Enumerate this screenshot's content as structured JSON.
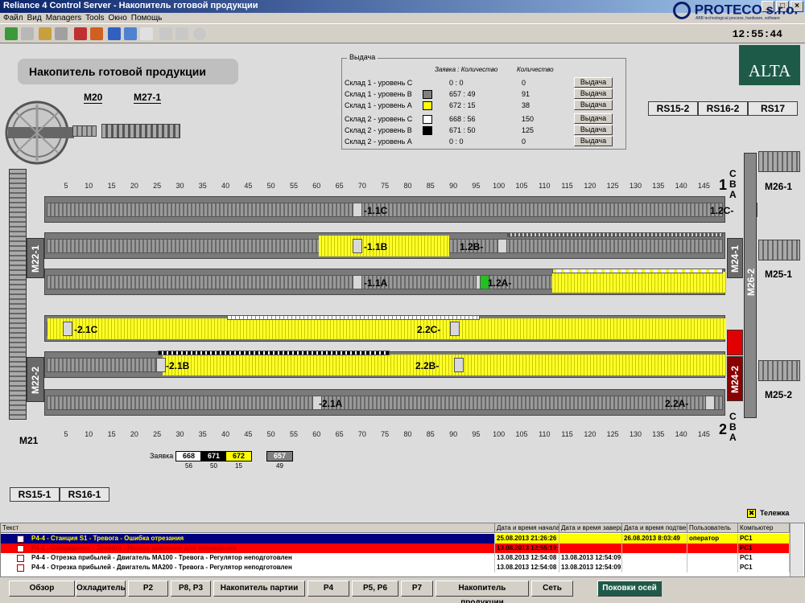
{
  "window": {
    "title": "Reliance 4 Control Server - Накопитель готовой продукции"
  },
  "menu": [
    "Файл",
    "Вид",
    "Managers",
    "Tools",
    "Окно",
    "Помощь"
  ],
  "clock": "12:55:44",
  "page": {
    "title": "Накопитель готовой продукции"
  },
  "machines": {
    "m20": "M20",
    "m27": "M27-1",
    "m21": "M21",
    "m22_1": "M22-1",
    "m22_2": "M22-2",
    "m24_1": "M24-1",
    "m24_2": "M24-2",
    "m26_1": "M26-1",
    "m26_2": "M26-2",
    "m25_1": "M25-1",
    "m25_2": "M25-2"
  },
  "issue": {
    "legend": "Выдача",
    "col_order": "Заявка : Количество",
    "col_count": "Количество",
    "button": "Выдача",
    "rows": [
      {
        "label": "Склад 1 - уровень C",
        "color": "",
        "order": "0 : 0",
        "count": "0"
      },
      {
        "label": "Склад 1 - уровень B",
        "color": "#808080",
        "order": "657 : 49",
        "count": "91"
      },
      {
        "label": "Склад 1 - уровень A",
        "color": "#ffff00",
        "order": "672 : 15",
        "count": "38"
      },
      {
        "label": "Склад 2 - уровень C",
        "color": "#ffffff",
        "order": "668 : 56",
        "count": "150"
      },
      {
        "label": "Склад 2 - уровень B",
        "color": "#000000",
        "order": "671 : 50",
        "count": "125"
      },
      {
        "label": "Склад 2 - уровень A",
        "color": "",
        "order": "0 : 0",
        "count": "0"
      }
    ]
  },
  "logo": "ALTA",
  "rs_top": [
    "RS15-2",
    "RS16-2",
    "RS17"
  ],
  "rs_bottom": [
    "RS15-1",
    "RS16-1"
  ],
  "scale": [
    "5",
    "10",
    "15",
    "20",
    "25",
    "30",
    "35",
    "40",
    "45",
    "50",
    "55",
    "60",
    "65",
    "70",
    "75",
    "80",
    "85",
    "90",
    "95",
    "100",
    "105",
    "110",
    "115",
    "120",
    "125",
    "130",
    "135",
    "140",
    "145"
  ],
  "side": {
    "s1_num": "1",
    "s2_num": "2",
    "c": "C",
    "b": "B",
    "a": "A"
  },
  "lanes": [
    {
      "left": "-1.1C",
      "right": "1.2C-"
    },
    {
      "left": "-1.1B",
      "right": "1.2B-"
    },
    {
      "left": "-1.1A",
      "right": "1.2A-"
    },
    {
      "left": "-2.1C",
      "right": "2.2C-"
    },
    {
      "left": "-2.1B",
      "right": "2.2B-"
    },
    {
      "left": "-2.1A",
      "right": "2.2A-"
    }
  ],
  "orders": {
    "label": "Заявка :",
    "items": [
      {
        "code": "668",
        "count": "56",
        "color": "#ffffff",
        "fg": "#000"
      },
      {
        "code": "671",
        "count": "50",
        "color": "#000000",
        "fg": "#fff"
      },
      {
        "code": "672",
        "count": "15",
        "color": "#ffff00",
        "fg": "#000"
      },
      {
        "code": "657",
        "count": "49",
        "color": "#808080",
        "fg": "#fff"
      }
    ]
  },
  "cart_legend": "Тележка",
  "alarm_table": {
    "headers": [
      "Текст",
      "Дата и время начала",
      "Дата и время заверш",
      "Дата и время подтвер",
      "Пользователь",
      "Компьютер"
    ],
    "rows": [
      {
        "text": "P4-4 - Станция S1 - Тревога - Ошибка отрезания",
        "start": "25.08.2013 21:26:26",
        "end": "",
        "ack": "26.08.2013 8:03:49",
        "user": "оператор",
        "pc": "PC1",
        "bg": "#000080",
        "fg": "#ffff00"
      },
      {
        "text": "P4-2 - Охлаждение - Тревога - Низкое давление для охлаждения",
        "start": "13.08.2013 12:55:19",
        "end": "",
        "ack": "",
        "user": "",
        "pc": "PC1",
        "bg": "#ff0000",
        "fg": "#ff0000"
      },
      {
        "text": "P4-4 - Отрезка прибылей - Двигатель MA100 - Тревога - Регулятор неподготовлен",
        "start": "13.08.2013 12:54:08",
        "end": "13.08.2013 12:54:09",
        "ack": "",
        "user": "",
        "pc": "PC1",
        "bg": "#ffffff",
        "fg": "#000"
      },
      {
        "text": "P4-4 - Отрезка прибылей - Двигатель MA200 - Тревога - Регулятор неподготовлен",
        "start": "13.08.2013 12:54:08",
        "end": "13.08.2013 12:54:09",
        "ack": "",
        "user": "",
        "pc": "PC1",
        "bg": "#ffffff",
        "fg": "#000"
      }
    ]
  },
  "nav": [
    "Обзор",
    "Охладитель",
    "P2",
    "P8, P3",
    "Накопитель партии",
    "P4",
    "P5, P6",
    "P7",
    "Накопитель продукции",
    "Сеть",
    "Поковки осей"
  ],
  "brand": "PROTECO s.r.o.",
  "brand_sub": "ABB technological process, hardware, software"
}
